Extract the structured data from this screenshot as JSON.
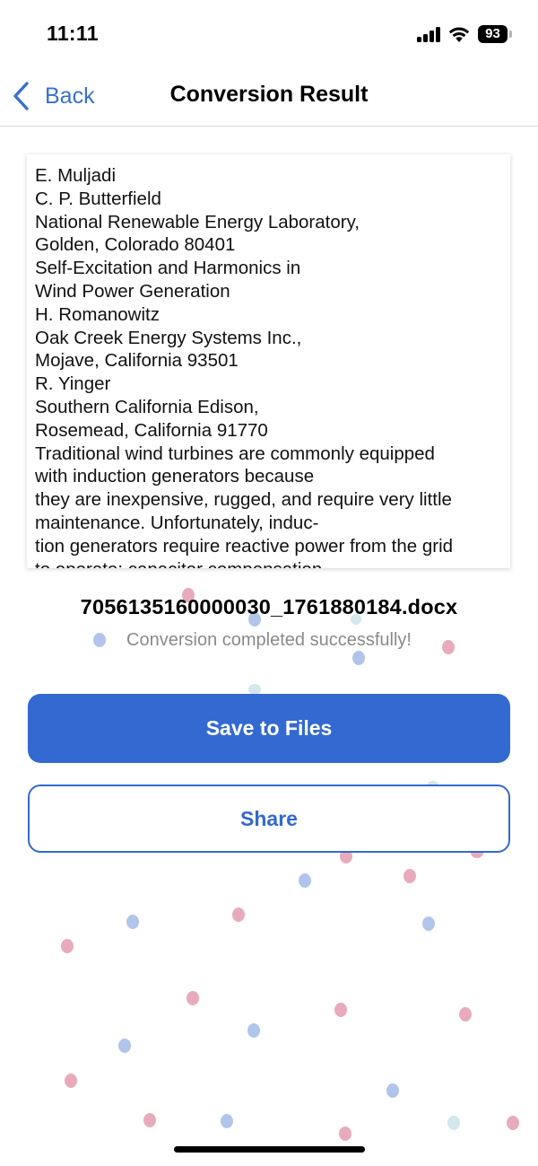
{
  "status_bar": {
    "time": "11:11",
    "battery": "93"
  },
  "nav": {
    "back_label": "Back",
    "title": "Conversion Result"
  },
  "preview": {
    "lines": [
      "E. Muljadi",
      "C. P. Butterfield",
      "National Renewable Energy Laboratory,",
      "Golden, Colorado 80401",
      "Self-Excitation and Harmonics in",
      "Wind Power Generation",
      "H. Romanowitz",
      "Oak Creek Energy Systems Inc.,",
      "Mojave, California 93501",
      "R. Yinger",
      "Southern California Edison,",
      "Rosemead, California 91770",
      "Traditional wind turbines are commonly equipped",
      "with induction generators because",
      "they are inexpensive, rugged, and require very little",
      "maintenance. Unfortunately, induc-",
      "tion generators require reactive power from the grid",
      "to operate; capacitor compensation"
    ]
  },
  "result": {
    "file_name": "7056135160000030_1761880184.docx",
    "status": "Conversion completed successfully!"
  },
  "actions": {
    "save_label": "Save to Files",
    "share_label": "Share"
  },
  "colors": {
    "accent": "#3369d1",
    "dot_pink": "#e5a3b5",
    "dot_blue": "#a7bde6"
  }
}
